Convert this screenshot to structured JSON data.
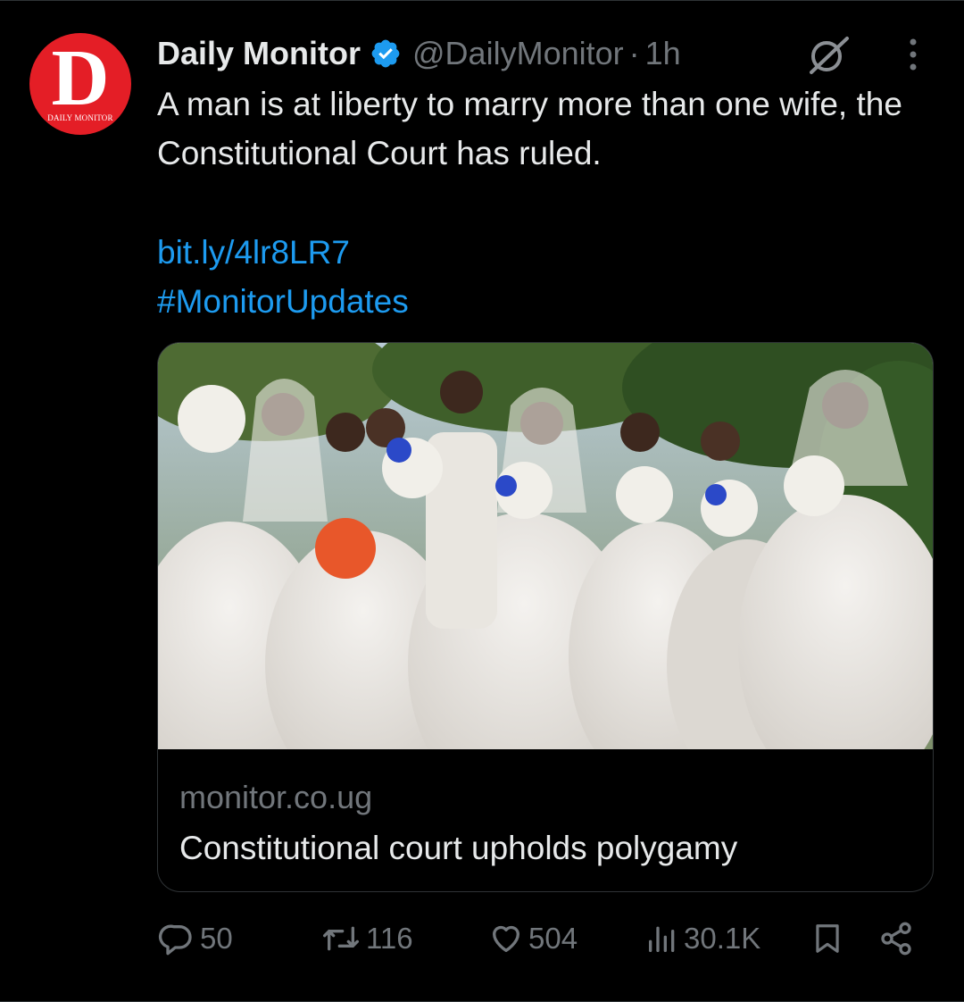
{
  "account": {
    "logo_letter": "D",
    "logo_text": "DAILY MONITOR",
    "display_name": "Daily Monitor",
    "handle": "@DailyMonitor",
    "separator": "·",
    "time": "1h"
  },
  "tweet": {
    "text": "A man is at liberty to marry more than one wife, the Constitutional Court has ruled.",
    "link": "bit.ly/4lr8LR7",
    "hashtag": "#MonitorUpdates"
  },
  "card": {
    "image_icon": "wedding-photo",
    "domain": "monitor.co.ug",
    "title": "Constitutional court upholds polygamy"
  },
  "actions": {
    "replies": "50",
    "reposts": "116",
    "likes": "504",
    "views": "30.1K"
  },
  "colors": {
    "background": "#000000",
    "text": "#e7e9ea",
    "secondary": "#71767b",
    "link": "#1d9bf0",
    "verified": "#1d9bf0",
    "brand_red": "#e41e26",
    "border": "#2f3336"
  }
}
